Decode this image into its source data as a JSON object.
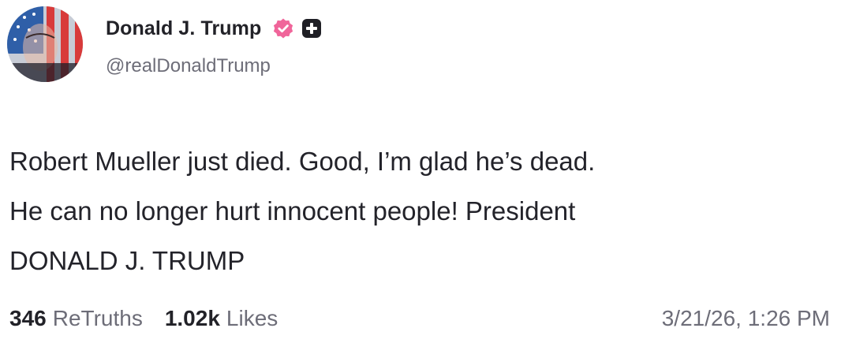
{
  "post": {
    "author": {
      "display_name": "Donald J. Trump",
      "handle": "@realDonaldTrump",
      "verified_badge_icon": "verified-check-icon",
      "extra_badge_icon": "plus-square-icon",
      "badge_color": "#f0659a"
    },
    "text": "Robert Mueller just died. Good, I’m glad he’s dead.\nHe can no longer hurt innocent people! President\nDONALD J. TRUMP",
    "stats": {
      "retruths_count": "346",
      "retruths_label": "ReTruths",
      "likes_count": "1.02k",
      "likes_label": "Likes"
    },
    "timestamp": "3/21/26, 1:26 PM"
  }
}
